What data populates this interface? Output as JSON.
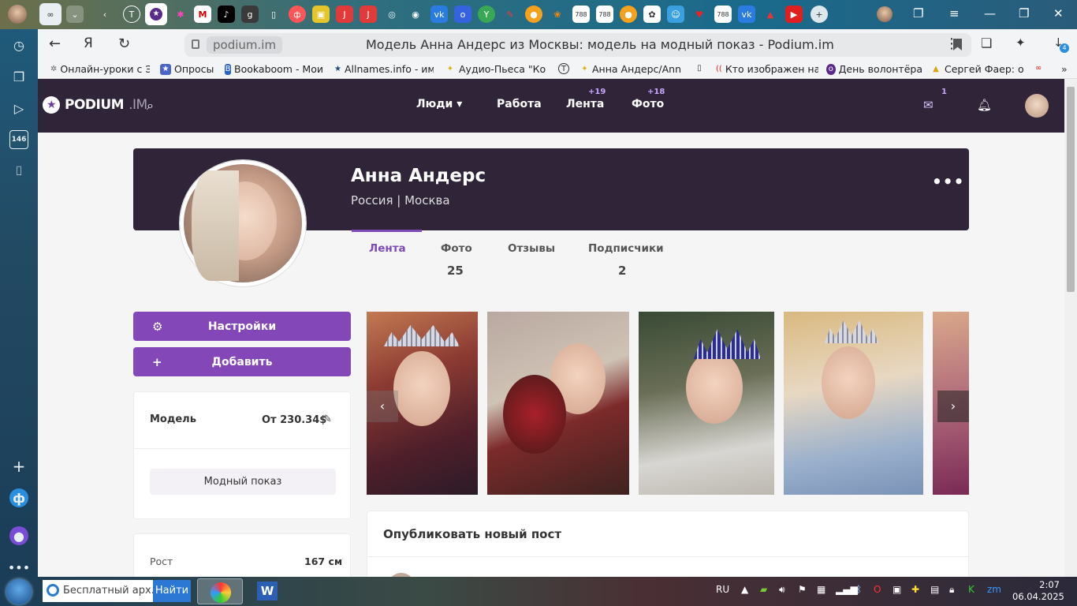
{
  "browser": {
    "url": "podium.im",
    "title": "Модель Анна Андерс из Москвы: модель на модный показ - Podium.im",
    "sidebar_counter": "146",
    "tab_badge": "4",
    "bookmarks": [
      {
        "label": "Онлайн-уроки с Э"
      },
      {
        "label": "Опросы"
      },
      {
        "label": "Bookaboom - Мои"
      },
      {
        "label": "Allnames.info - им"
      },
      {
        "label": "Аудио-Пьеса \"Ко"
      },
      {
        "label": "Анна Андерс/Ann"
      },
      {
        "label": "Кто изображен на"
      },
      {
        "label": "День волонтёра"
      },
      {
        "label": "Сергей Фаер: о"
      }
    ]
  },
  "site": {
    "logo_main": "PODIUM",
    "logo_suffix": ".IM",
    "nav": {
      "people": "Люди",
      "work": "Работа",
      "feed": "Лента",
      "feed_badge": "+19",
      "photo": "Фото",
      "photo_badge": "+18",
      "mail_badge": "1"
    }
  },
  "profile": {
    "name": "Анна Андерс",
    "location": "Россия | Москва",
    "more": "•••",
    "tabs": [
      {
        "label": "Лента",
        "count": ""
      },
      {
        "label": "Фото",
        "count": "25"
      },
      {
        "label": "Отзывы",
        "count": ""
      },
      {
        "label": "Подписчики",
        "count": "2"
      }
    ],
    "settings_button": "Настройки",
    "add_button": "Добавить",
    "role": "Модель",
    "price": "От 230.34$",
    "tag": "Модный показ",
    "height_label": "Рост",
    "height_value": "167 см",
    "post_title": "Опубликовать новый пост"
  },
  "taskbar": {
    "search_text": "Бесплатный арх...",
    "find_button": "Найти",
    "lang": "RU",
    "time": "2:07",
    "date": "06.04.2025"
  }
}
